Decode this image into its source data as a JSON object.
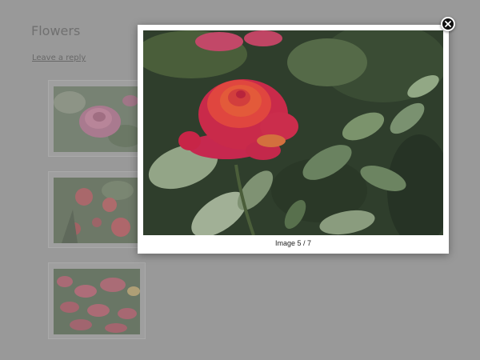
{
  "post": {
    "title": "Flowers",
    "reply_link": "Leave a reply"
  },
  "gallery": {
    "thumbnails": [
      {
        "subject": "pink rose"
      },
      {
        "subject": "red rose cluster"
      },
      {
        "subject": "rose bush"
      }
    ]
  },
  "lightbox": {
    "caption": "Image 5 / 7",
    "close_icon": "close-icon",
    "photo_subject": "red-orange rose with green leaves"
  },
  "colors": {
    "overlay": "#9a9a9a",
    "lightbox_bg": "#ffffff",
    "close_button": "#111111"
  }
}
